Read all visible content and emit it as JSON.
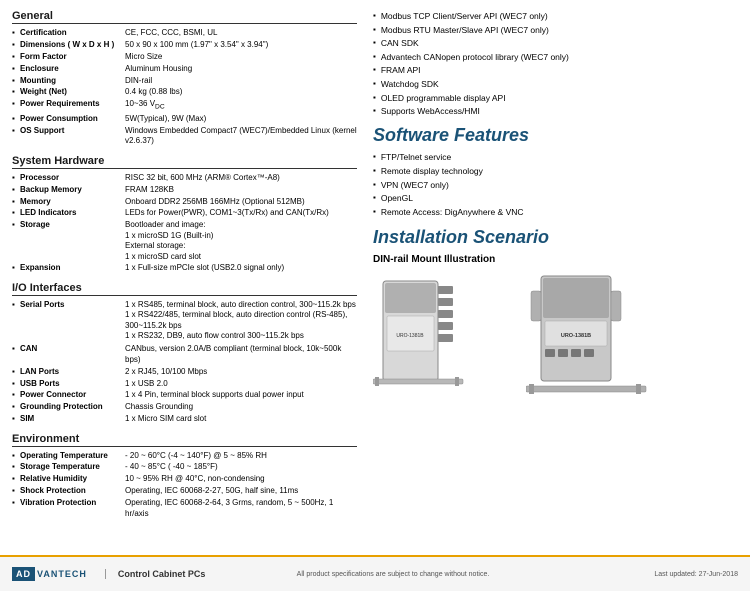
{
  "sections": {
    "general": {
      "title": "General",
      "specs": [
        {
          "key": "Certification",
          "val": "CE, FCC, CCC, BSMI, UL"
        },
        {
          "key": "Dimensions ( W x D x H )",
          "val": "50 x 90 x 100 mm (1.97\" x 3.54\" x 3.94\")"
        },
        {
          "key": "Form Factor",
          "val": "Micro Size"
        },
        {
          "key": "Enclosure",
          "val": "Aluminum Housing"
        },
        {
          "key": "Mounting",
          "val": "DIN-rail"
        },
        {
          "key": "Weight (Net)",
          "val": "0.4 kg (0.88 lbs)"
        },
        {
          "key": "Power Requirements",
          "val": "10~36 VDC"
        },
        {
          "key": "Power Consumption",
          "val": "5W(Typical), 9W (Max)"
        },
        {
          "key": "OS Support",
          "val": "Windows Embedded Compact7 (WEC7)/Embedded Linux (kernel v2.6.37)"
        }
      ]
    },
    "system_hardware": {
      "title": "System Hardware",
      "specs": [
        {
          "key": "Processor",
          "val": "RISC 32 bit, 600 MHz (ARM® Cortex™-A8)"
        },
        {
          "key": "Backup Memory",
          "val": "FRAM 128KB"
        },
        {
          "key": "Memory",
          "val": "Onboard DDR2 256MB 166MHz (Optional 512MB)"
        },
        {
          "key": "LED Indicators",
          "val": "LEDs for Power(PWR), COM1~3(Tx/Rx) and CAN(Tx/Rx)"
        },
        {
          "key": "Storage",
          "val": "Bootloader and image:\n1 x microSD 1G (Built-in)\nExternal storage:\n1 x microSD card slot"
        },
        {
          "key": "Expansion",
          "val": "1 x Full-size mPCIe slot (USB2.0 signal only)"
        }
      ]
    },
    "io_interfaces": {
      "title": "I/O Interfaces",
      "specs": [
        {
          "key": "Serial Ports",
          "val": "1 x RS485, terminal block, auto direction control, 300~115.2k bps\n1 x RS422/485, terminal block, auto direction control (RS-485), 300~115.2k bps\n1 x RS232, DB9, auto flow control 300~115.2k bps"
        },
        {
          "key": "CAN",
          "val": "CANbus, version 2.0A/B compliant (terminal block, 10k~500k bps)"
        },
        {
          "key": "LAN Ports",
          "val": "2 x RJ45, 10/100 Mbps"
        },
        {
          "key": "USB Ports",
          "val": "1 x USB 2.0"
        },
        {
          "key": "Power Connector",
          "val": "1 x 4 Pin, terminal block supports dual power input"
        },
        {
          "key": "Grounding Protection",
          "val": "Chassis Grounding"
        },
        {
          "key": "SIM",
          "val": "1 x Micro SIM card slot"
        }
      ]
    },
    "environment": {
      "title": "Environment",
      "specs": [
        {
          "key": "Operating Temperature",
          "val": "- 20 ~ 60°C (-4 ~ 140°F) @ 5 ~ 85% RH"
        },
        {
          "key": "Storage Temperature",
          "val": "- 40 ~ 85°C ( -40 ~ 185°F)"
        },
        {
          "key": "Relative Humidity",
          "val": "10 ~ 95% RH @ 40°C, non-condensing"
        },
        {
          "key": "Shock Protection",
          "val": "Operating, IEC 60068-2-27, 50G, half sine, 11ms"
        },
        {
          "key": "Vibration Protection",
          "val": "Operating, IEC 60068-2-64, 3 Grms, random, 5 ~ 500Hz, 1 hr/axis"
        }
      ]
    }
  },
  "right_section": {
    "top_bullets": [
      "Modbus TCP Client/Server API (WEC7 only)",
      "Modbus RTU Master/Slave API (WEC7 only)",
      "CAN SDK",
      "Advantech CANopen protocol library (WEC7 only)",
      "FRAM API",
      "Watchdog SDK",
      "OLED programmable display API",
      "Supports WebAccess/HMI"
    ],
    "software_features": {
      "title": "Software Features",
      "items": [
        "FTP/Telnet service",
        "Remote display technology",
        "VPN (WEC7 only)",
        "OpenGL",
        "Remote Access: DigAnywhere & VNC"
      ]
    },
    "installation": {
      "title": "Installation Scenario",
      "sub_title": "DIN-rail Mount Illustration"
    }
  },
  "footer": {
    "logo_adv": "AD",
    "logo_van": "VANTECH",
    "logo_full": "ADVANTECH",
    "category": "Control Cabinet PCs",
    "note": "All product specifications are subject to change without notice.",
    "date": "Last updated: 27-Jun-2018"
  }
}
